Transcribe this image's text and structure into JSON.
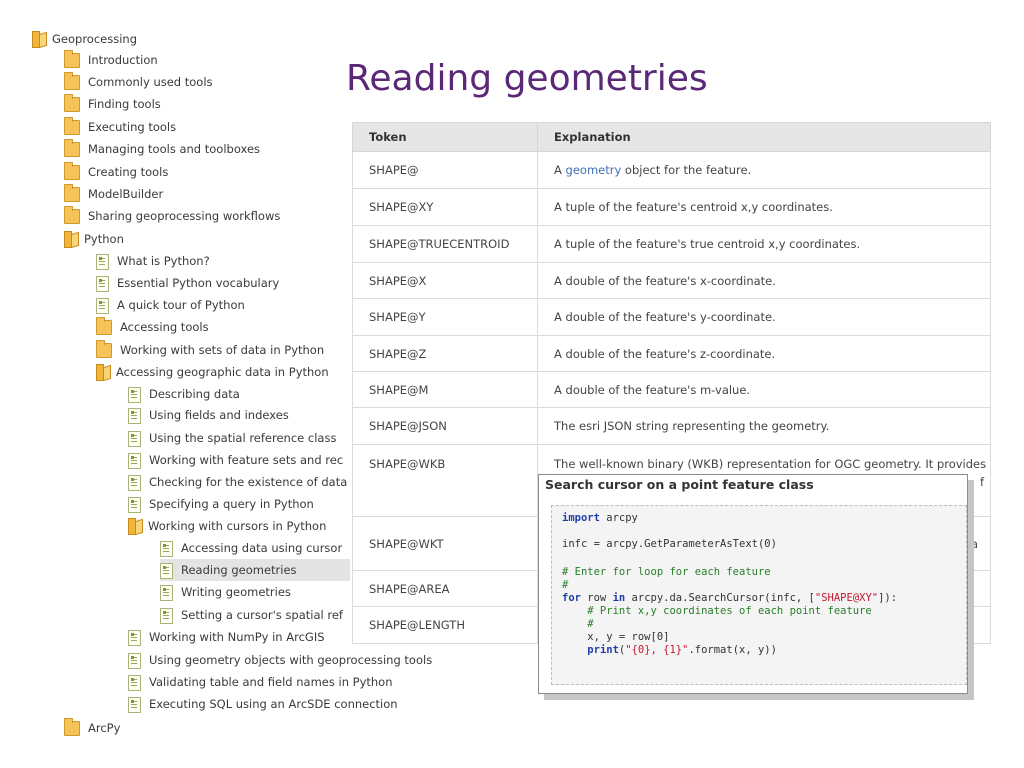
{
  "page_title": "Reading geometries",
  "tree": {
    "root": "Geoprocessing",
    "l1": [
      "Introduction",
      "Commonly used tools",
      "Finding tools",
      "Executing tools",
      "Managing tools and toolboxes",
      "Creating tools",
      "ModelBuilder",
      "Sharing geoprocessing workflows"
    ],
    "python": "Python",
    "python_children": [
      "What is Python?",
      "Essential Python vocabulary",
      "A quick tour of Python",
      "Accessing tools",
      "Working with sets of data in Python"
    ],
    "geodata": "Accessing geographic data in Python",
    "geodata_children_a": [
      "Describing data",
      "Using fields and indexes",
      "Using the spatial reference class",
      "Working with feature sets and rec",
      "Checking for the existence of data",
      "Specifying a query in Python"
    ],
    "cursors": "Working with cursors in Python",
    "cursors_children": [
      "Accessing data using cursor",
      "Reading geometries",
      "Writing geometries",
      "Setting a cursor's spatial ref"
    ],
    "geodata_children_b": [
      "Working with NumPy in ArcGIS",
      "Using geometry objects with geoprocessing tools",
      "Validating table and field names in Python",
      "Executing SQL using an ArcSDE connection"
    ],
    "arcpy": "ArcPy"
  },
  "table": {
    "headers": [
      "Token",
      "Explanation"
    ],
    "rows": [
      {
        "token": "SHAPE@",
        "pre": "A ",
        "link": "geometry",
        "post": " object for the feature."
      },
      {
        "token": "SHAPE@XY",
        "text": "A tuple of the feature's centroid x,y coordinates."
      },
      {
        "token": "SHAPE@TRUECENTROID",
        "text": "A tuple of the feature's true centroid x,y coordinates."
      },
      {
        "token": "SHAPE@X",
        "text": "A double of the feature's x-coordinate."
      },
      {
        "token": "SHAPE@Y",
        "text": "A double of the feature's y-coordinate."
      },
      {
        "token": "SHAPE@Z",
        "text": "A double of the feature's z-coordinate."
      },
      {
        "token": "SHAPE@M",
        "text": "A double of the feature's m-value."
      },
      {
        "token": "SHAPE@JSON",
        "text": "The esri JSON string representing the geometry."
      },
      {
        "token": "SHAPE@WKB",
        "text": "The well-known binary (WKB) representation for OGC geometry. It provides",
        "tail": "f"
      },
      {
        "token": "SHAPE@WKT",
        "tail": "a"
      },
      {
        "token": "SHAPE@AREA"
      },
      {
        "token": "SHAPE@LENGTH"
      }
    ]
  },
  "popup": {
    "title": "Search cursor on a point feature class",
    "code": {
      "l1_kw": "import",
      "l1_rest": " arcpy",
      "l2": "infc = arcpy.GetParameterAsText(0)",
      "l3": "# Enter for loop for each feature",
      "l4": "#",
      "l5_kw": "for",
      "l5_a": " row ",
      "l5_kw2": "in",
      "l5_b": " arcpy.da.SearchCursor(infc, [",
      "l5_str": "\"SHAPE@XY\"",
      "l5_c": "]):",
      "l6": "    # Print x,y coordinates of each point feature",
      "l7": "    #",
      "l8": "    x, y = row[0]",
      "l9_indent": "    ",
      "l9_kw": "print",
      "l9_a": "(",
      "l9_str": "\"{0}, {1}\"",
      "l9_b": ".format(x, y))"
    }
  }
}
